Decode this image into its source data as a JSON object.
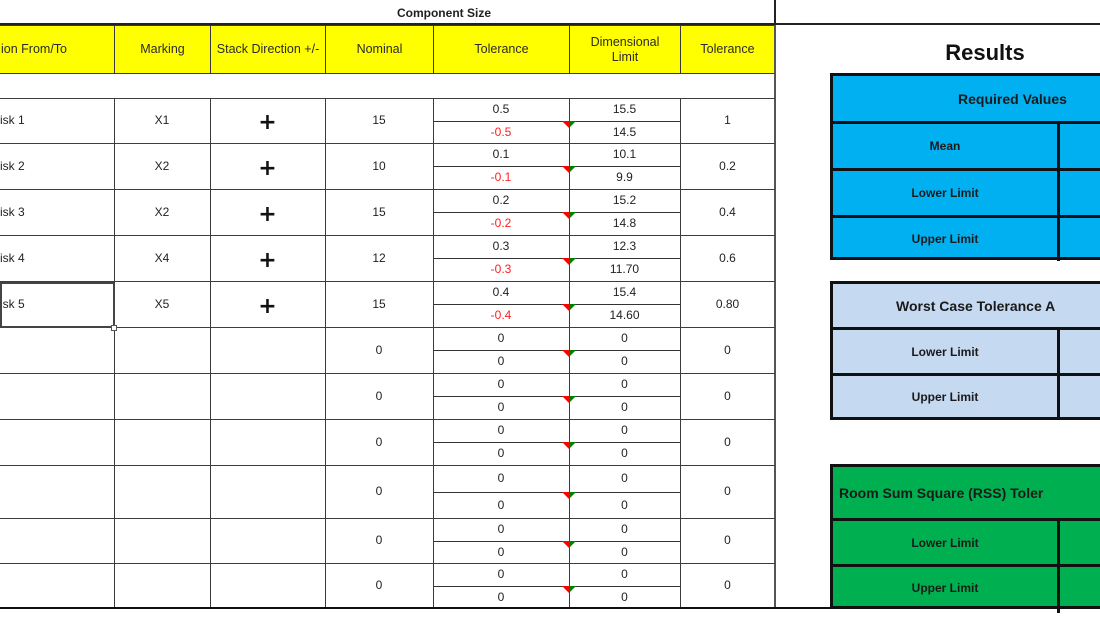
{
  "section_title": "Component Size",
  "headers": {
    "location": "ion From/To",
    "marking": "Marking",
    "stack_direction": "Stack Direction +/-",
    "nominal": "Nominal",
    "tolerance": "Tolerance",
    "dimensional_limit": "Dimensional Limit",
    "tolerance_total": "Tolerance"
  },
  "rows": [
    {
      "location": "isk 1",
      "marking": "X1",
      "direction": "+",
      "nominal": "15",
      "tol_plus": "0.5",
      "tol_minus": "-0.5",
      "limit_upper": "15.5",
      "limit_lower": "14.5",
      "tolerance": "1"
    },
    {
      "location": "isk 2",
      "marking": "X2",
      "direction": "+",
      "nominal": "10",
      "tol_plus": "0.1",
      "tol_minus": "-0.1",
      "limit_upper": "10.1",
      "limit_lower": "9.9",
      "tolerance": "0.2"
    },
    {
      "location": "isk 3",
      "marking": "X2",
      "direction": "+",
      "nominal": "15",
      "tol_plus": "0.2",
      "tol_minus": "-0.2",
      "limit_upper": "15.2",
      "limit_lower": "14.8",
      "tolerance": "0.4"
    },
    {
      "location": "isk 4",
      "marking": "X4",
      "direction": "+",
      "nominal": "12",
      "tol_plus": "0.3",
      "tol_minus": "-0.3",
      "limit_upper": "12.3",
      "limit_lower": "11.70",
      "tolerance": "0.6"
    },
    {
      "location": "isk 5",
      "marking": "X5",
      "direction": "+",
      "nominal": "15",
      "tol_plus": "0.4",
      "tol_minus": "-0.4",
      "limit_upper": "15.4",
      "limit_lower": "14.60",
      "tolerance": "0.80"
    },
    {
      "location": "",
      "marking": "",
      "direction": "",
      "nominal": "0",
      "tol_plus": "0",
      "tol_minus": "0",
      "limit_upper": "0",
      "limit_lower": "0",
      "tolerance": "0"
    },
    {
      "location": "",
      "marking": "",
      "direction": "",
      "nominal": "0",
      "tol_plus": "0",
      "tol_minus": "0",
      "limit_upper": "0",
      "limit_lower": "0",
      "tolerance": "0"
    },
    {
      "location": "",
      "marking": "",
      "direction": "",
      "nominal": "0",
      "tol_plus": "0",
      "tol_minus": "0",
      "limit_upper": "0",
      "limit_lower": "0",
      "tolerance": "0"
    },
    {
      "location": "",
      "marking": "",
      "direction": "",
      "nominal": "0",
      "tol_plus": "0",
      "tol_minus": "0",
      "limit_upper": "0",
      "limit_lower": "0",
      "tolerance": "0"
    },
    {
      "location": "",
      "marking": "",
      "direction": "",
      "nominal": "0",
      "tol_plus": "0",
      "tol_minus": "0",
      "limit_upper": "0",
      "limit_lower": "0",
      "tolerance": "0"
    },
    {
      "location": "",
      "marking": "",
      "direction": "",
      "nominal": "0",
      "tol_plus": "0",
      "tol_minus": "0",
      "limit_upper": "0",
      "limit_lower": "0",
      "tolerance": "0"
    }
  ],
  "results": {
    "title": "Results",
    "required": {
      "title": "Required Values",
      "rows": [
        "Mean",
        "Lower Limit",
        "Upper Limit"
      ],
      "color": "#00b0f0"
    },
    "worst_case": {
      "title": "Worst Case Tolerance A",
      "rows": [
        "Lower Limit",
        "Upper Limit"
      ],
      "color": "#c5d9f1"
    },
    "rss": {
      "title": "Room Sum Square (RSS) Toler",
      "rows": [
        "Lower Limit",
        "Upper Limit"
      ],
      "color": "#00b050"
    }
  },
  "colors": {
    "header_bg": "#ffff00",
    "negative": "#ff2020",
    "indicator_red": "#ff0000",
    "indicator_green": "#008000"
  }
}
